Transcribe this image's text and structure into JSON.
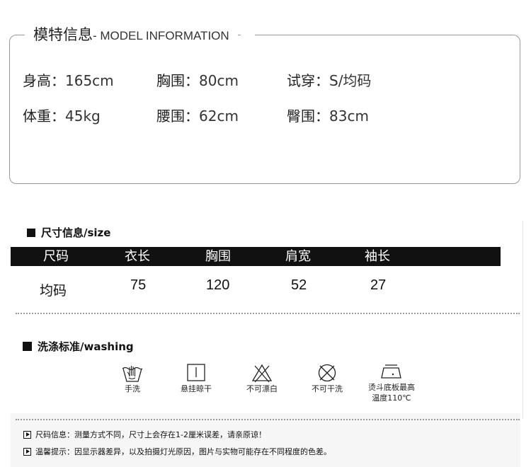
{
  "model": {
    "title_cn": "模特信息",
    "title_en": "- MODEL INFORMATION",
    "height": {
      "label": "身高：",
      "value": "165cm"
    },
    "bust": {
      "label": "胸围：",
      "value": "80cm"
    },
    "try_size": {
      "label": "试穿：",
      "value": "S/均码"
    },
    "weight": {
      "label": "体重：",
      "value": "45kg"
    },
    "waist": {
      "label": "腰围：",
      "value": "62cm"
    },
    "hip": {
      "label": "臀围：",
      "value": "83cm"
    }
  },
  "size_section": {
    "title": "尺寸信息/size",
    "headers": [
      "尺码",
      "衣长",
      "胸围",
      "肩宽",
      "袖长"
    ],
    "row": [
      "均码",
      "75",
      "120",
      "52",
      "27"
    ]
  },
  "washing_section": {
    "title": "洗涤标准/washing",
    "items": [
      {
        "icon": "hand-wash-icon",
        "caption": "手洗"
      },
      {
        "icon": "hang-dry-icon",
        "caption": "悬挂晾干"
      },
      {
        "icon": "no-bleach-icon",
        "caption": "不可漂白"
      },
      {
        "icon": "no-dry-clean-icon",
        "caption": "不可干洗"
      },
      {
        "icon": "iron-icon",
        "caption_line1": "烫斗底板最高",
        "caption_line2": "温度110℃"
      }
    ]
  },
  "notes": {
    "size_note": "尺码信息：测量方式不同，尺寸上会存在1-2厘米误差，请亲原谅！",
    "display_note": "温馨提示：因显示器差异，以及拍摄灯光原因，图片与实物可能存在不同程度的色差。"
  }
}
